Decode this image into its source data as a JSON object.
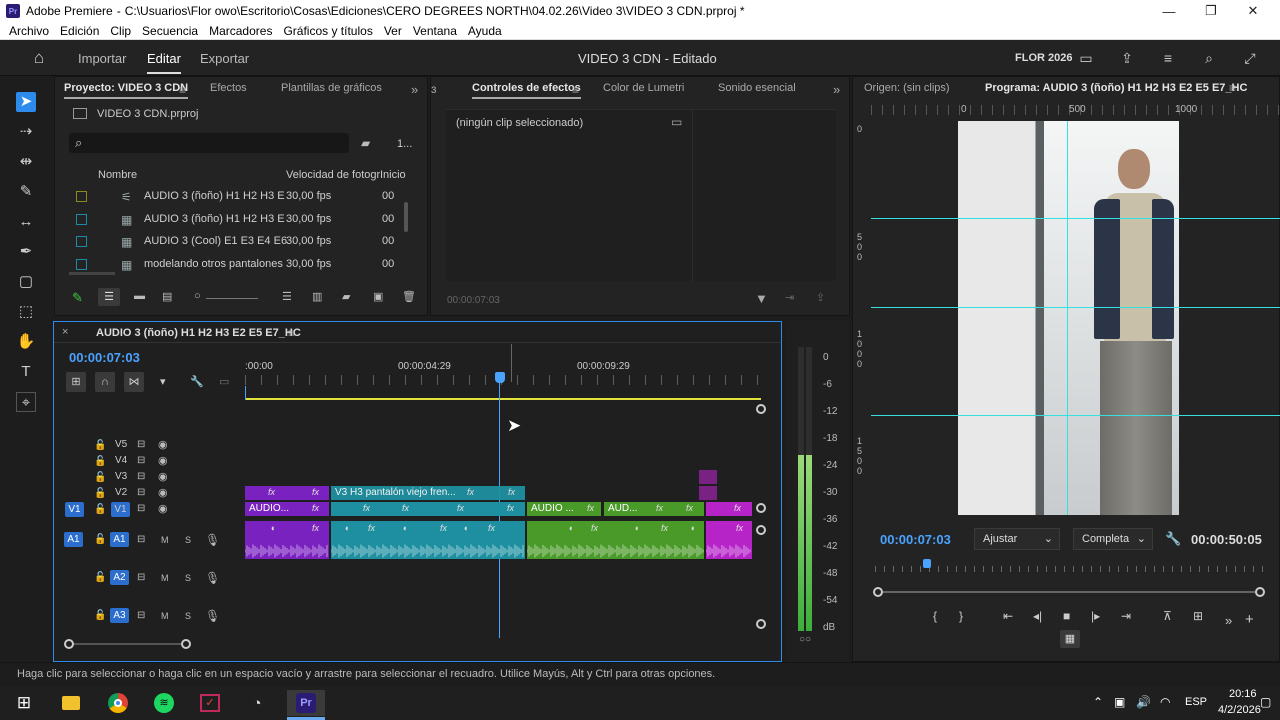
{
  "window": {
    "app_name": "Adobe Premiere",
    "path": "C:\\Usuarios\\Flor owo\\Escritorio\\Cosas\\Ediciones\\CERO DEGREES NORTH\\04.02.26\\Video 3\\VIDEO 3 CDN.prproj *"
  },
  "menu": [
    "Archivo",
    "Edición",
    "Clip",
    "Secuencia",
    "Marcadores",
    "Gráficos y títulos",
    "Ver",
    "Ventana",
    "Ayuda"
  ],
  "header": {
    "nav": [
      "Importar",
      "Editar",
      "Exportar"
    ],
    "active_nav": "Editar",
    "title": "VIDEO 3 CDN - Editado",
    "workspace": "FLOR 2026"
  },
  "project_panel": {
    "tabs": [
      "Proyecto: VIDEO 3 CDN",
      "Efectos",
      "Plantillas de gráficos"
    ],
    "file": "VIDEO 3 CDN.prproj",
    "count": "1...",
    "columns": [
      "Nombre",
      "Velocidad de fotogr",
      "Inicio"
    ],
    "rows": [
      {
        "name": "AUDIO 3 (ñoño) H1 H2 H3 E",
        "fps": "30,00 fps",
        "start": "00",
        "swatch": "#8a8a1f",
        "icon": "multicam-icon"
      },
      {
        "name": "AUDIO 3 (ñoño) H1 H2 H3 E",
        "fps": "30,00 fps",
        "start": "00",
        "swatch": "#1f8aa8",
        "icon": "sequence-icon"
      },
      {
        "name": "AUDIO 3 (Cool) E1 E3 E4 E6",
        "fps": "30,00 fps",
        "start": "00",
        "swatch": "#1f8aa8",
        "icon": "sequence-icon"
      },
      {
        "name": "modelando otros pantalones",
        "fps": "30,00 fps",
        "start": "00",
        "swatch": "#1f8aa8",
        "icon": "sequence-icon"
      }
    ]
  },
  "effects_panel": {
    "tabs": [
      "Controles de efectos",
      "Color de Lumetri",
      "Sonido esencial"
    ],
    "empty_msg": "(ningún clip seleccionado)",
    "timecode": "00:00:07:03"
  },
  "timeline": {
    "sequence_name": "AUDIO 3 (ñoño) H1 H2 H3 E2 E5 E7_HC",
    "timecode": "00:00:07:03",
    "ruler": [
      ":00:00",
      "00:00:04:29",
      "00:00:09:29"
    ],
    "video_tracks": [
      "V5",
      "V4",
      "V3",
      "V2",
      "V1"
    ],
    "audio_tracks": [
      "A1",
      "A2",
      "A3"
    ],
    "source_v1": "V1",
    "source_a1": "A1",
    "clips": {
      "v2_title": "V3 H3 pantalón viejo fren...",
      "v1_a": "AUDIO...",
      "v1_b": "AUDIO ...",
      "v1_c": "AUD..."
    },
    "fx_label": "fx",
    "m_label": "M",
    "s_label": "S"
  },
  "meters": {
    "scale": [
      "0",
      "-6",
      "-12",
      "-18",
      "-24",
      "-30",
      "-36",
      "-42",
      "-48",
      "-54",
      "dB"
    ],
    "level": 0.62
  },
  "program_monitor": {
    "source_tab": "Origen: (sin clips)",
    "program_tab": "Programa: AUDIO 3 (ñoño) H1 H2 H3 E2 E5 E7_HC",
    "ruler": [
      "0",
      "500",
      "1000"
    ],
    "timecode": "00:00:07:03",
    "fit": "Ajustar",
    "quality": "Completa",
    "duration": "00:00:50:05"
  },
  "status_bar": "Haga clic para seleccionar o haga clic en un espacio vacío y arrastre para seleccionar el recuadro. Utilice Mayús, Alt y Ctrl para otras opciones.",
  "taskbar": {
    "lang": "ESP",
    "time": "20:16",
    "date": "4/2/2026"
  },
  "colors": {
    "accent": "#2d8ceb",
    "violet_clip": "#7a22c0",
    "teal_clip": "#1e8fa0",
    "green_clip": "#4a9a2a",
    "magenta_clip": "#b624c8",
    "work_area": "#e2e23c",
    "guide": "#35e0e0"
  }
}
